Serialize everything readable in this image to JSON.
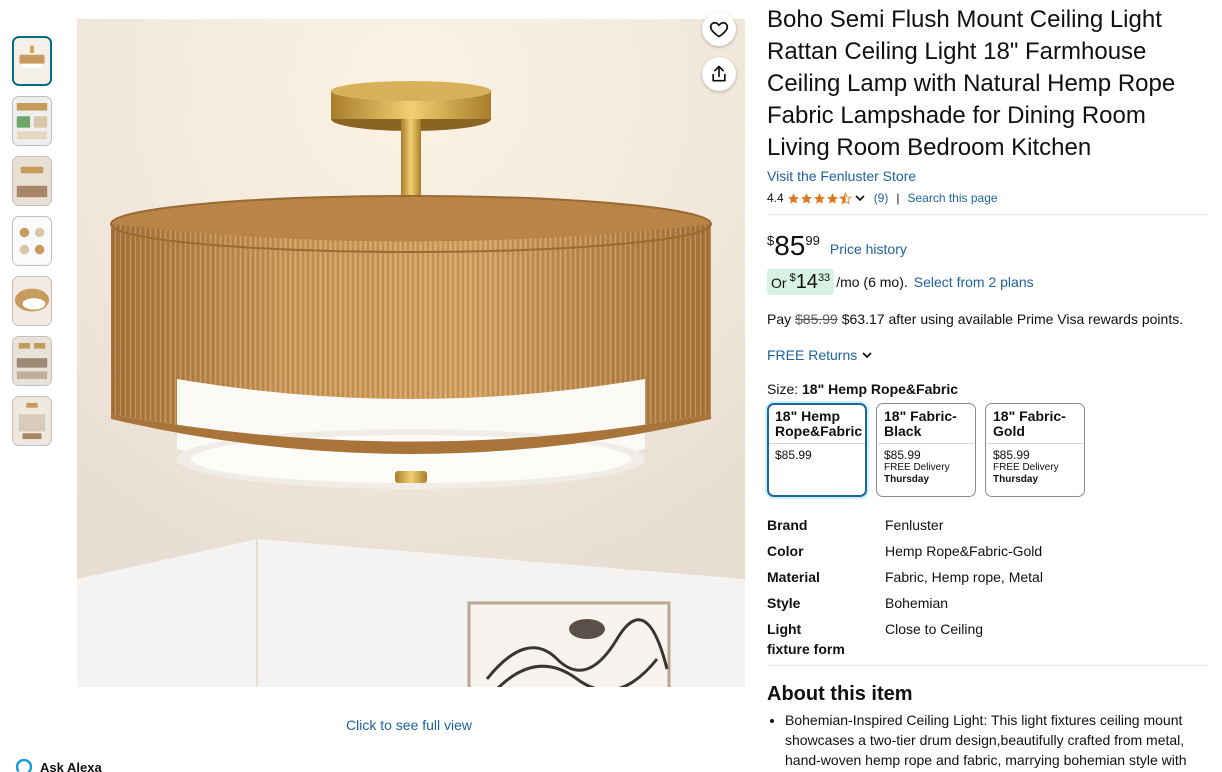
{
  "product": {
    "title": "Boho Semi Flush Mount Ceiling Light Rattan Ceiling Light 18\" Farmhouse Ceiling Lamp with Natural Hemp Rope Fabric Lampshade for Dining Room Living Room Bedroom Kitchen",
    "store_link": "Visit the Fenluster Store",
    "rating": "4.4",
    "rating_stars": 4.4,
    "rating_count": "(9)",
    "search_page": "Search this page"
  },
  "price": {
    "symbol": "$",
    "whole": "85",
    "fraction": "99",
    "history_link": "Price history"
  },
  "monthly": {
    "or": "Or",
    "symbol": "$",
    "whole": "14",
    "fraction": "33",
    "suffix": "/mo (6 mo).",
    "plans_link": "Select from 2 plans"
  },
  "prime_visa": {
    "pay": "Pay",
    "old_price": "$85.99",
    "text": "$63.17 after using available Prime Visa rewards points."
  },
  "returns": {
    "label": "FREE Returns"
  },
  "size": {
    "label": "Size:",
    "selected": "18\" Hemp Rope&Fabric",
    "options": [
      {
        "name": "18\" Hemp Rope&Fabric",
        "price": "$85.99",
        "delivery": "",
        "day": ""
      },
      {
        "name": "18\" Fabric-Black",
        "price": "$85.99",
        "delivery": "FREE Delivery",
        "day": "Thursday"
      },
      {
        "name": "18\" Fabric-Gold",
        "price": "$85.99",
        "delivery": "FREE Delivery",
        "day": "Thursday"
      }
    ]
  },
  "specs": [
    {
      "key": "Brand",
      "value": "Fenluster"
    },
    {
      "key": "Color",
      "value": "Hemp Rope&Fabric-Gold"
    },
    {
      "key": "Material",
      "value": "Fabric, Hemp rope, Metal"
    },
    {
      "key": "Style",
      "value": "Bohemian"
    },
    {
      "key": "Light fixture form",
      "value": "Close to Ceiling"
    }
  ],
  "about": {
    "heading": "About this item",
    "bullets": [
      "Bohemian-Inspired Ceiling Light: This light fixtures ceiling mount showcases a two-tier drum design,beautifully crafted from metal, hand-woven hemp rope and fabric, marrying bohemian style with"
    ]
  },
  "image": {
    "full_view_link": "Click to see full view",
    "thumbnail_count": 7
  },
  "alexa": {
    "label": "Ask Alexa"
  },
  "colors": {
    "link": "#2162a1",
    "star": "#de7921",
    "monthly_bg": "#d7f2e3",
    "selected_border": "#2162a1"
  }
}
